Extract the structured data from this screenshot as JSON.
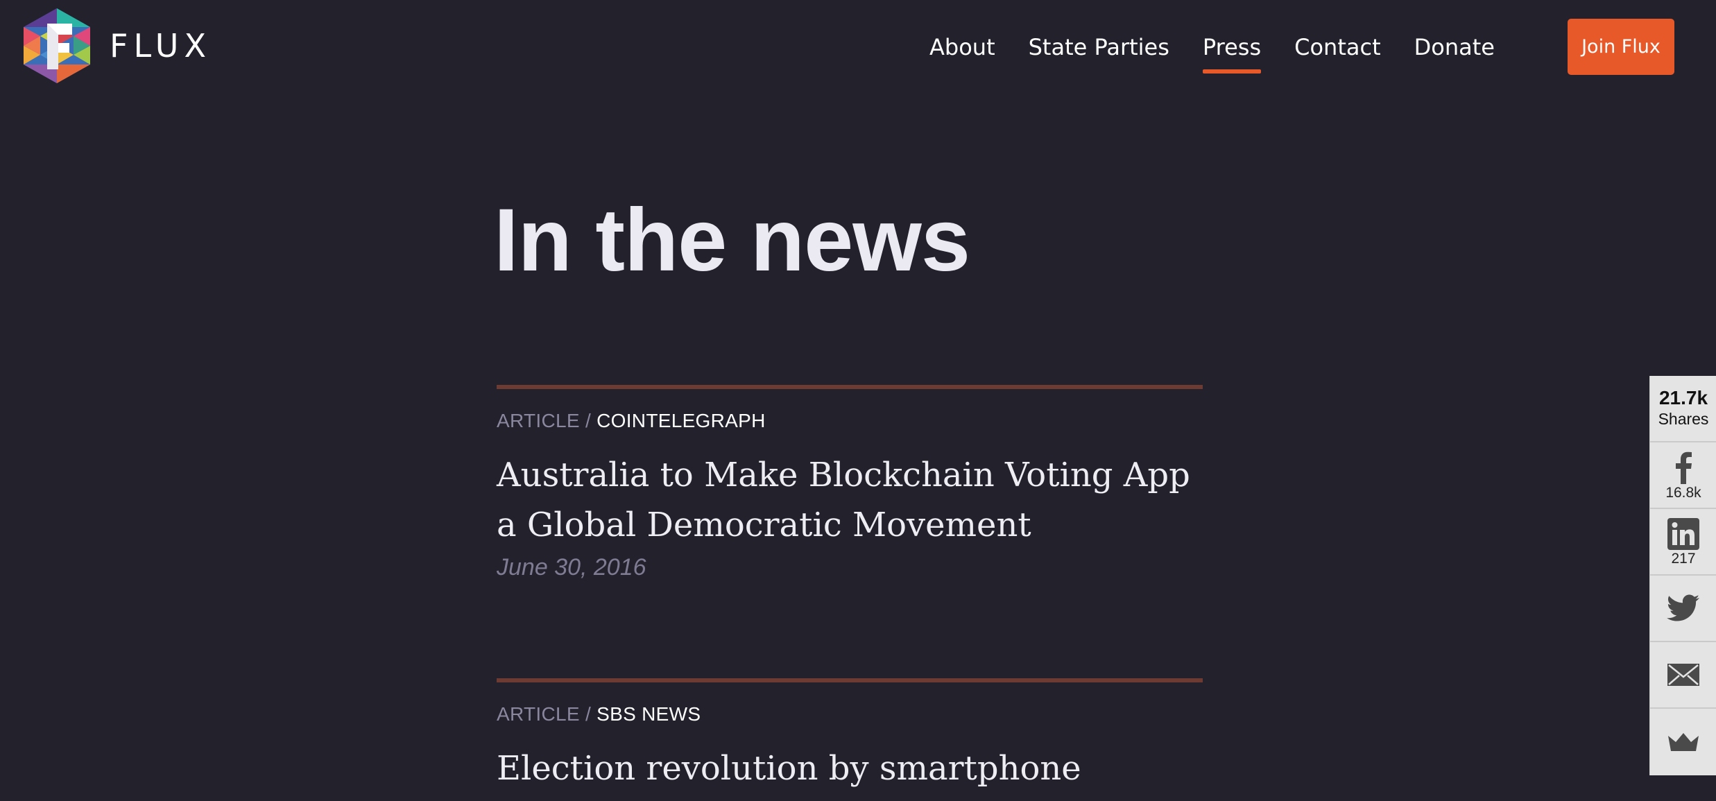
{
  "header": {
    "brand": "FLUX",
    "nav": [
      {
        "label": "About",
        "active": false
      },
      {
        "label": "State Parties",
        "active": false
      },
      {
        "label": "Press",
        "active": true
      },
      {
        "label": "Contact",
        "active": false
      },
      {
        "label": "Donate",
        "active": false
      }
    ],
    "join_label": "Join Flux"
  },
  "main": {
    "title": "In the news",
    "articles": [
      {
        "type": "ARTICLE",
        "separator": "/",
        "source": "COINTELEGRAPH",
        "headline": "Australia to Make Blockchain Voting App a Global Democratic Movement",
        "date": "June 30, 2016"
      },
      {
        "type": "ARTICLE",
        "separator": "/",
        "source": "SBS NEWS",
        "headline": "Election revolution by smartphone",
        "date": ""
      }
    ]
  },
  "share_bar": {
    "total": "21.7k",
    "total_label": "Shares",
    "items": [
      {
        "icon": "facebook-icon",
        "count": "16.8k"
      },
      {
        "icon": "linkedin-icon",
        "count": "217"
      },
      {
        "icon": "twitter-icon",
        "count": ""
      },
      {
        "icon": "email-icon",
        "count": ""
      },
      {
        "icon": "crown-icon",
        "count": ""
      }
    ]
  },
  "colors": {
    "background": "#22212c",
    "accent": "#e8592a",
    "rule": "#6e3b33",
    "muted": "#8a879e",
    "share_bg": "#e4e4e4"
  }
}
